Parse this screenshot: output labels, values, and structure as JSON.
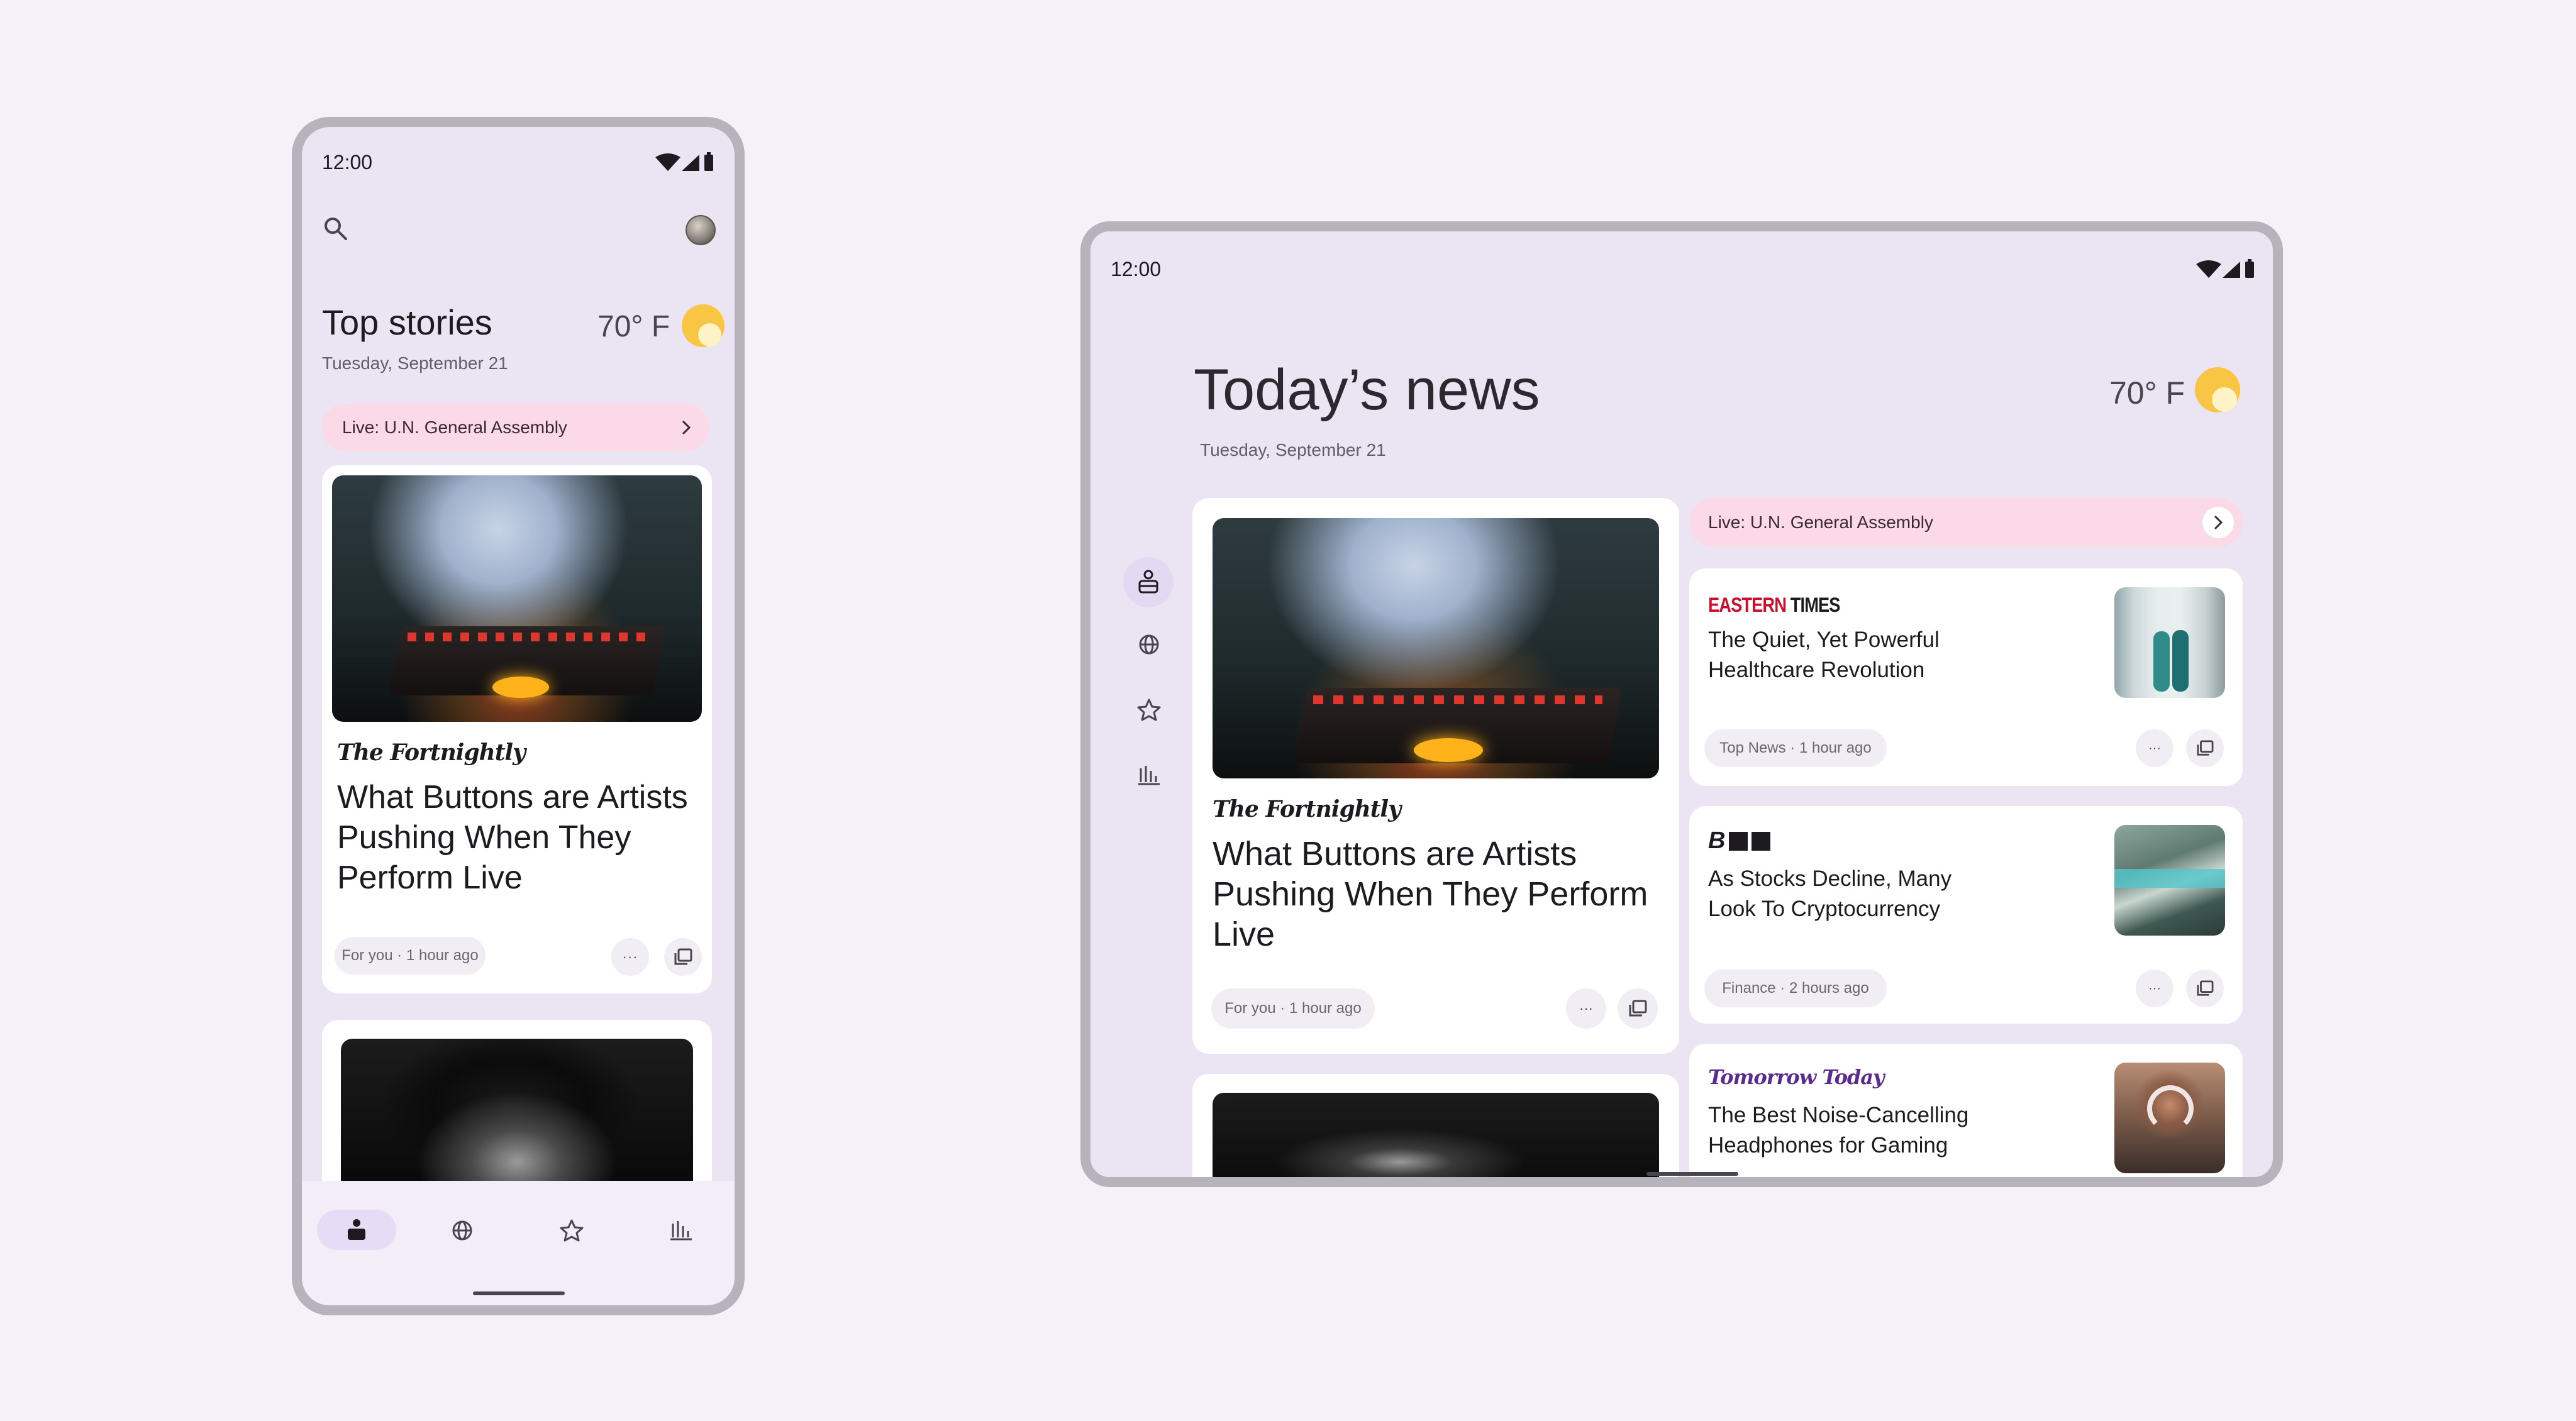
{
  "colors": {
    "background": "#f5f1f9",
    "surface": "#ebe4f3",
    "card": "#ffffff",
    "live_banner": "#fcd9e6",
    "nav_active": "#e6dcf5",
    "sun": "#f9c544",
    "eastern_red": "#c8102e",
    "tomorrow_purple": "#5b2c8f"
  },
  "phone": {
    "status": {
      "time": "12:00"
    },
    "header": {
      "title": "Top stories",
      "date": "Tuesday, September 21",
      "temperature": "70° F"
    },
    "live_banner": {
      "label": "Live: U.N. General Assembly"
    },
    "card1": {
      "publication": "The Fortnightly",
      "headline": "What Buttons are Artists Pushing When They Perform Live",
      "meta": "For you · 1 hour ago"
    },
    "bottom_nav": [
      {
        "icon": "for-you-icon"
      },
      {
        "icon": "globe-icon"
      },
      {
        "icon": "star-icon"
      },
      {
        "icon": "chart-icon"
      }
    ]
  },
  "tablet": {
    "status": {
      "time": "12:00"
    },
    "header": {
      "title": "Today’s news",
      "date": "Tuesday, September 21",
      "temperature": "70° F"
    },
    "live_banner": {
      "label": "Live: U.N. General Assembly"
    },
    "main_card": {
      "publication": "The Fortnightly",
      "headline": "What Buttons are Artists Pushing When They Perform Live",
      "meta": "For you · 1 hour ago"
    },
    "side_cards": [
      {
        "publication_a": "EASTERN",
        "publication_b": "TIMES",
        "headline": "The Quiet, Yet Powerful Healthcare Revolution",
        "meta": "Top News · 1 hour ago"
      },
      {
        "publication": "B",
        "headline": "As Stocks Decline, Many Look To Cryptocurrency",
        "meta": "Finance · 2 hours ago"
      },
      {
        "publication": "Tomorrow Today",
        "headline": "The Best Noise-Cancelling Headphones for Gaming"
      }
    ],
    "nav_rail": [
      {
        "icon": "for-you-icon"
      },
      {
        "icon": "globe-icon"
      },
      {
        "icon": "star-icon"
      },
      {
        "icon": "chart-icon"
      }
    ]
  }
}
